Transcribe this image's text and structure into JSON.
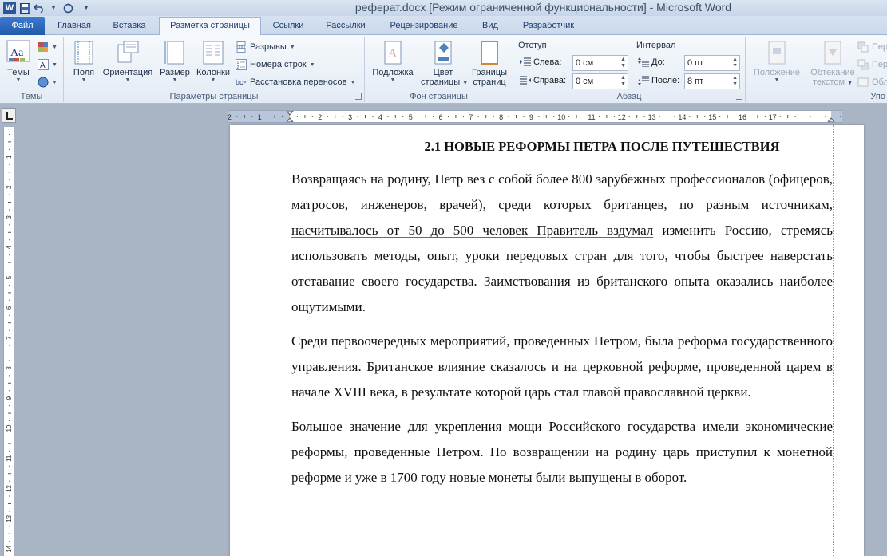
{
  "window": {
    "title": "реферат.docx [Режим ограниченной функциональности]  -  Microsoft Word",
    "app_icon": "W"
  },
  "quick_access": {
    "save_icon": "save-icon",
    "undo_icon": "undo-icon",
    "redo_icon": "redo-icon"
  },
  "tabs": [
    {
      "label": "Файл"
    },
    {
      "label": "Главная"
    },
    {
      "label": "Вставка"
    },
    {
      "label": "Разметка страницы"
    },
    {
      "label": "Ссылки"
    },
    {
      "label": "Рассылки"
    },
    {
      "label": "Рецензирование"
    },
    {
      "label": "Вид"
    },
    {
      "label": "Разработчик"
    }
  ],
  "ribbon": {
    "themes": {
      "group_label": "Темы",
      "themes_label": "Темы"
    },
    "page_setup": {
      "group_label": "Параметры страницы",
      "margins": "Поля",
      "orientation": "Ориентация",
      "size": "Размер",
      "columns": "Колонки",
      "breaks": "Разрывы",
      "line_numbers": "Номера строк",
      "hyphenation": "Расстановка переносов"
    },
    "page_background": {
      "group_label": "Фон страницы",
      "watermark": "Подложка",
      "page_color_1": "Цвет",
      "page_color_2": "страницы",
      "borders_1": "Границы",
      "borders_2": "страниц"
    },
    "paragraph": {
      "group_label": "Абзац",
      "indent_header": "Отступ",
      "left_label": "Слева:",
      "left_value": "0 см",
      "right_label": "Справа:",
      "right_value": "0 см",
      "spacing_header": "Интервал",
      "before_label": "До:",
      "before_value": "0 пт",
      "after_label": "После:",
      "after_value": "8 пт"
    },
    "arrange": {
      "position": "Положение",
      "wrap_1": "Обтекание",
      "wrap_2": "текстом",
      "cut_1": "Пер",
      "cut_2": "Пер",
      "cut_3": "Обл",
      "group_cut": "Упо"
    }
  },
  "document": {
    "heading": "2.1 НОВЫЕ РЕФОРМЫ ПЕТРА ПОСЛЕ ПУТЕШЕСТВИЯ",
    "p1_a": "Возвращаясь на родину, Петр вез с собой более 800 зарубежных профессионалов (офицеров, матросов, инженеров, врачей), среди которых британцев, по разным источникам, ",
    "p1_underlined": "насчитывалось от 50 до 500 человек Правитель вздумал",
    "p1_b": " изменить Россию, стремясь использовать методы, опыт, уроки передовых стран для того, чтобы быстрее наверстать отставание своего государства. Заимствования из британского опыта оказались наиболее ощутимыми.",
    "p2": "Среди первоочередных мероприятий, проведенных Петром, была реформа государственного управления. Британское влияние сказалось и на церковной реформе, проведенной царем в начале XVIII века, в результате которой царь стал главой православной церкви.",
    "p3": "Большое значение для укрепления мощи Российского государства имели экономические реформы, проведенные Петром. По возвращении на родину царь приступил к монетной реформе и уже в 1700 году новые монеты были выпущены в оборот."
  },
  "ruler": {
    "h_numbers": [
      "2",
      "1",
      "1",
      "2",
      "3",
      "4",
      "5",
      "6",
      "7",
      "8",
      "9",
      "10",
      "11",
      "12",
      "13",
      "14",
      "15",
      "16",
      "17"
    ],
    "v_numbers": [
      "1",
      "2",
      "3",
      "4",
      "5",
      "6",
      "7",
      "8",
      "9",
      "10",
      "11",
      "12",
      "13",
      "14"
    ]
  }
}
